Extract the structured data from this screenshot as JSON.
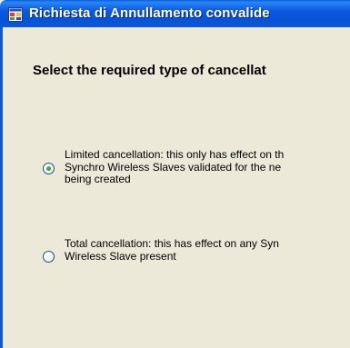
{
  "window": {
    "title": "Richiesta di Annullamento convalide",
    "title_bar_color": "#0a58dd"
  },
  "heading": "Select the required type of cancellat",
  "options": [
    {
      "label": "Limited cancellation: this only has effect on th\nSynchro Wireless Slaves validated for the ne\nbeing created",
      "selected": true
    },
    {
      "label": "Total cancellation: this has effect on any Syn\nWireless Slave present",
      "selected": false
    }
  ],
  "colors": {
    "window_background": "#ece9d8",
    "radio_selected_dot": "#21a121"
  },
  "icons": {
    "app": "app-window-icon"
  }
}
